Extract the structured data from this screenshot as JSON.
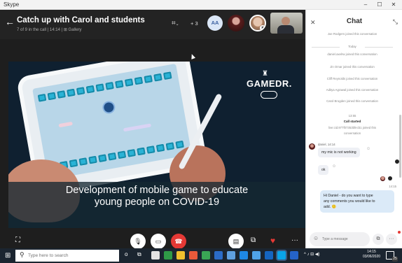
{
  "titlebar": {
    "app_name": "Skype",
    "minimize": "–",
    "maximize": "☐",
    "close": "✕"
  },
  "call": {
    "back_icon": "←",
    "title": "Catch up with Carol and students",
    "subtitle": "7 of 9 in the call | 14:14  |  ⊞ Gallery",
    "layout_icon": "⌗",
    "layout_caret": "⌄",
    "more_participants": "+ 3",
    "self_initials": "AA",
    "muted_icon": "✖",
    "video_logo": "GAMEDR.",
    "video_logo_hat": "♜",
    "caption_line1": "Development of mobile game to educate",
    "caption_line2": "young people on COVID-19"
  },
  "controls": {
    "fullscreen": "⛶",
    "mic": "🎙",
    "camera": "▭",
    "hangup": "☎",
    "chat": "▤",
    "share": "⧉",
    "react": "♥",
    "more": "···"
  },
  "chat": {
    "close": "✕",
    "title": "Chat",
    "expand": "⤡",
    "system_top": "Joe Rodgers joined this conversation",
    "today": "Today",
    "joined": [
      "daniel.axelrw joined this conversation",
      "Jin Omar joined this conversation",
      "Cliff Reynolds joined this conversation",
      "Aditya Agrawal joined this conversation",
      "Carol Brogden joined this conversation"
    ],
    "call_time": "13:55",
    "call_started": "Call started",
    "joined_live1": "live:cid.977f07353bfecb1 joined this",
    "joined_live2": "conversation",
    "messages": [
      {
        "meta": "daniel, 14:14",
        "text": "my mic is not working",
        "react": "☺"
      },
      {
        "text": "ok",
        "react": "☺"
      }
    ],
    "out_time": "14:15",
    "out_text_1": "Hi Daniel - do you want to type",
    "out_text_2": "any comments you would like to",
    "out_text_3": "add. 🙂",
    "composer_emoji": "☺",
    "composer_placeholder": "Type a message",
    "attach": "⧉",
    "more": "···"
  },
  "taskbar": {
    "start": "⊞",
    "search_icon": "⚲",
    "search_placeholder": "Type here to search",
    "icons": [
      "o",
      "⧉"
    ],
    "clock_time": "14:15",
    "clock_date": "03/06/2020",
    "tray": "^  ♪  ⊟  ◀)",
    "action_badge": "25"
  }
}
